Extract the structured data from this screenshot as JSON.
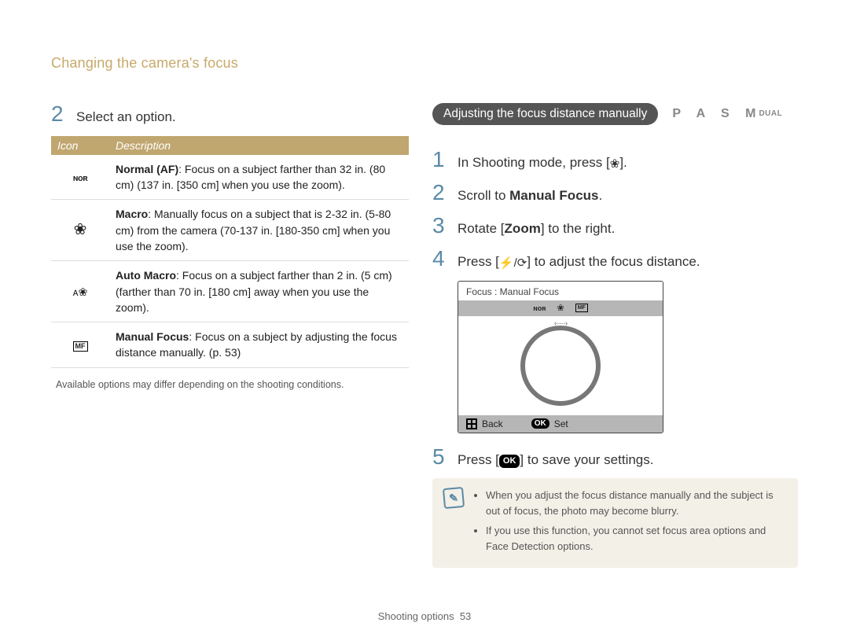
{
  "breadcrumb": "Changing the camera's focus",
  "left": {
    "step_num": "2",
    "step_text": "Select an option.",
    "table": {
      "headers": [
        "Icon",
        "Description"
      ],
      "rows": [
        {
          "icon": "nor-icon",
          "glyph": "ɴᴏʀ",
          "label": "Normal (AF)",
          "text": ": Focus on a subject farther than 32 in. (80 cm) (137 in. [350 cm] when you use the zoom)."
        },
        {
          "icon": "macro-icon",
          "glyph": "❀",
          "label": "Macro",
          "text": ": Manually focus on a subject that is 2-32 in. (5-80 cm) from the camera (70-137 in. [180-350 cm] when you use the zoom)."
        },
        {
          "icon": "auto-macro-icon",
          "glyph": "ᴀ❀",
          "label": "Auto Macro",
          "text": ": Focus on a subject farther than 2 in. (5 cm) (farther than 70 in. [180 cm] away when you use the zoom)."
        },
        {
          "icon": "mf-icon",
          "glyph": "MF",
          "label": "Manual Focus",
          "text": ": Focus on a subject by adjusting the focus distance manually. (p. 53)"
        }
      ]
    },
    "note": "Available options may differ depending on the shooting conditions."
  },
  "right": {
    "pill": "Adjusting the focus distance manually",
    "modes": "P A S M",
    "modes_dual": "DUAL",
    "steps": [
      {
        "num": "1",
        "pre": "In Shooting mode, press [",
        "glyph": "❀",
        "post": "]."
      },
      {
        "num": "2",
        "pre": "Scroll to ",
        "bold": "Manual Focus",
        "post": "."
      },
      {
        "num": "3",
        "pre": "Rotate [",
        "bold": "Zoom",
        "post": "] to the right."
      },
      {
        "num": "4",
        "pre": "Press [",
        "glyph": "⚡/⟳",
        "post": "] to adjust the focus distance."
      }
    ],
    "lcd": {
      "title": "Focus : Manual Focus",
      "bar_icons": [
        "ɴᴏʀ",
        "❀",
        "MF"
      ],
      "back": "Back",
      "set": "Set",
      "ok": "OK"
    },
    "step5": {
      "num": "5",
      "pre": "Press [",
      "ok": "OK",
      "post": "] to save your settings."
    },
    "tips": [
      "When you adjust the focus distance manually and the subject is out of focus, the photo may become blurry.",
      "If you use this function, you cannot set focus area options and Face Detection options."
    ]
  },
  "footer": {
    "section": "Shooting options",
    "page": "53"
  }
}
